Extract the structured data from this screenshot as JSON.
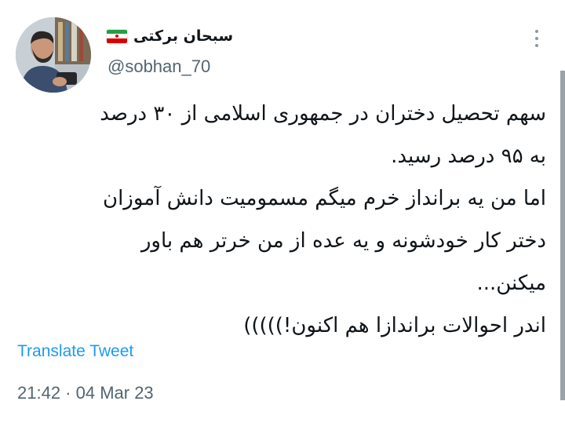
{
  "author": {
    "display_name": "سبحان برکتی",
    "handle": "@sobhan_70",
    "avatar_icon": "profile-photo",
    "badge_icon": "iran-flag-emoji",
    "badge_colors": [
      "#239f40",
      "#ffffff",
      "#da0000"
    ]
  },
  "menu": {
    "icon": "more-vertical-icon"
  },
  "tweet": {
    "lines": [
      "سهم تحصیل دختران در جمهوری اسلامی از ۳۰ درصد",
      "به ۹۵ درصد رسید.",
      "اما من یه برانداز خرم میگم مسمومیت دانش آموزان",
      "دختر کار خودشونه و یه عده از من خرتر هم باور",
      "میکنن...",
      "اندر احوالات براندازا هم اکنون!)))))"
    ],
    "translate_label": "Translate Tweet",
    "timestamp": "21:42 · 04 Mar 23"
  },
  "colors": {
    "link": "#1d9bf0",
    "secondary_text": "#536471",
    "primary_text": "#0f1419"
  }
}
